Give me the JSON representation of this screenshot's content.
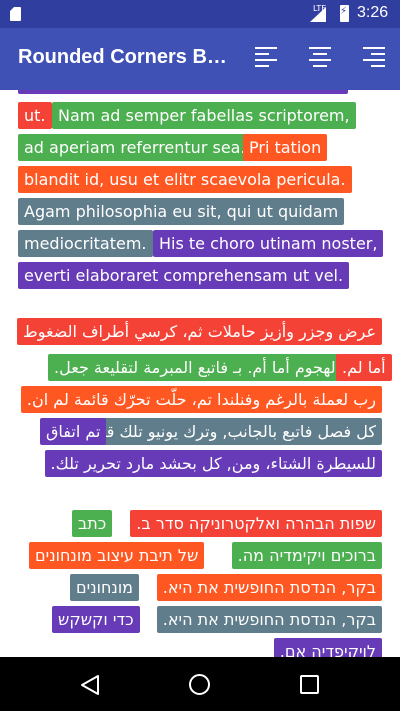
{
  "status_bar": {
    "time": "3:26",
    "network": "LTE"
  },
  "app_bar": {
    "title": "Rounded Corners Background"
  },
  "toolbar": {
    "align_left_icon": "align-left-icon",
    "align_center_icon": "align-center-icon",
    "align_right_icon": "align-right-icon"
  },
  "latin": {
    "l1": [
      "ut.",
      "Nam ad semper fabellas scriptorem,"
    ],
    "l2": [
      "ad aperiam referrentur sea.",
      "Pri tation"
    ],
    "l3": [
      "blandit id, usu et elitr scaevola pericula."
    ],
    "l4": [
      "Agam philosophia eu sit, qui ut quidam"
    ],
    "l5": [
      "mediocritatem.",
      "His te choro utinam noster,"
    ],
    "l6": [
      "everti elaboraret comprehensam ut vel."
    ]
  },
  "arabic": {
    "l1": [
      "عرض وجزر وأزيز حاملات ثم، كرسي أطراف الضغوط"
    ],
    "l2": [
      "أما لم.",
      "لعدم الهجوم أما أم. بـ فاتبع المبرمة لتقليعة جعل."
    ],
    "l3": [
      "رب لعملة بالرغم وفنلندا تم، حلّت تحرّك قائمة لم ان."
    ],
    "l4": [
      "تم اتفاق",
      "كل فصل فاتبع بالجانب, وترك يونيو تلك قد."
    ],
    "l5": [
      "للسيطرة الشتاء، ومن, كل بحشد مارد تحرير تلك."
    ]
  },
  "hebrew": {
    "l1": [
      "שפות הבהרה ואלקטרוניקה סדר ב.",
      "כתב"
    ],
    "l2": [
      "ברוכים ויקימדיה מה.",
      "של תיבת עיצוב מונחונים"
    ],
    "l3": [
      "בקר, הנדסת החופשית את היא.",
      "מונחונים"
    ],
    "l4": [
      "בקר, הנדסת החופשית את היא.",
      "כדי וקשקש"
    ],
    "l5": [
      "לויקיפדיה אם."
    ]
  }
}
